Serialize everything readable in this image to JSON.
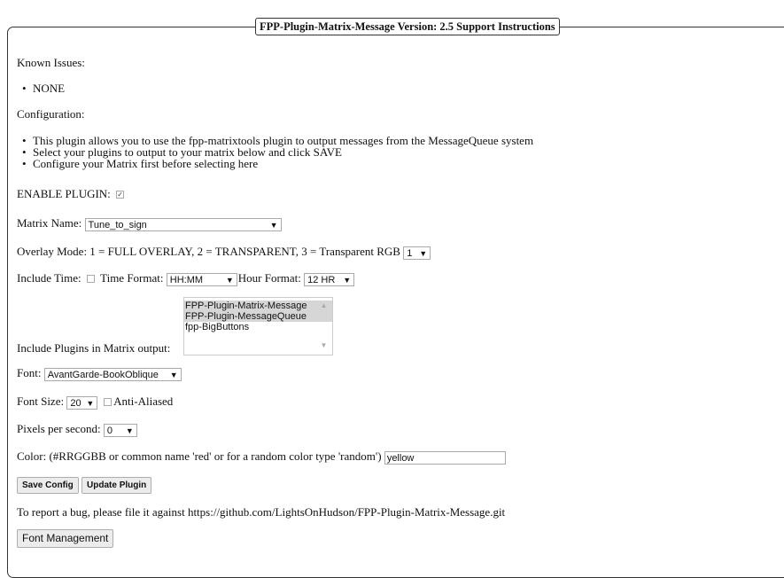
{
  "legend": "FPP-Plugin-Matrix-Message Version: 2.5 Support Instructions",
  "known_issues": {
    "label": "Known Issues:",
    "items": [
      "NONE"
    ]
  },
  "configuration": {
    "label": "Configuration:",
    "items": [
      "This plugin allows you to use the fpp-matrixtools plugin to output messages from the MessageQueue system",
      "Select your plugins to output to your matrix below and click SAVE",
      "Configure your Matrix first before selecting here"
    ]
  },
  "enable_plugin": {
    "label": "ENABLE PLUGIN:",
    "checked": true,
    "mark": "✓"
  },
  "matrix_name": {
    "label": "Matrix Name:",
    "value": "Tune_to_sign"
  },
  "overlay_mode": {
    "label": "Overlay Mode: 1 = FULL OVERLAY, 2 = TRANSPARENT, 3 = Transparent RGB",
    "value": "1"
  },
  "include_time": {
    "label": "Include Time:",
    "checked": false,
    "time_format_label": "Time Format:",
    "time_format_value": "HH:MM",
    "hour_format_label": "Hour Format:",
    "hour_format_value": "12 HR"
  },
  "include_plugins": {
    "label": "Include Plugins in Matrix output:",
    "options": [
      {
        "text": "FPP-Plugin-Matrix-Message",
        "selected": true
      },
      {
        "text": "FPP-Plugin-MessageQueue",
        "selected": true
      },
      {
        "text": "fpp-BigButtons",
        "selected": false
      }
    ]
  },
  "font": {
    "label": "Font:",
    "value": "AvantGarde-BookOblique"
  },
  "font_size": {
    "label": "Font Size:",
    "value": "20",
    "anti_aliased_label": "Anti-Aliased",
    "anti_aliased_checked": false
  },
  "pixels_per_second": {
    "label": "Pixels per second:",
    "value": "0"
  },
  "color": {
    "label": "Color: (#RRGGBB or common name 'red' or for a random color type 'random')",
    "value": "yellow"
  },
  "buttons": {
    "save_config": "Save Config",
    "update_plugin": "Update Plugin"
  },
  "bug_report": "To report a bug, please file it against https://github.com/LightsOnHudson/FPP-Plugin-Matrix-Message.git",
  "font_management": "Font Management",
  "dropdown_arrow": "▼",
  "scroll_up": "▲",
  "scroll_down": "▼"
}
